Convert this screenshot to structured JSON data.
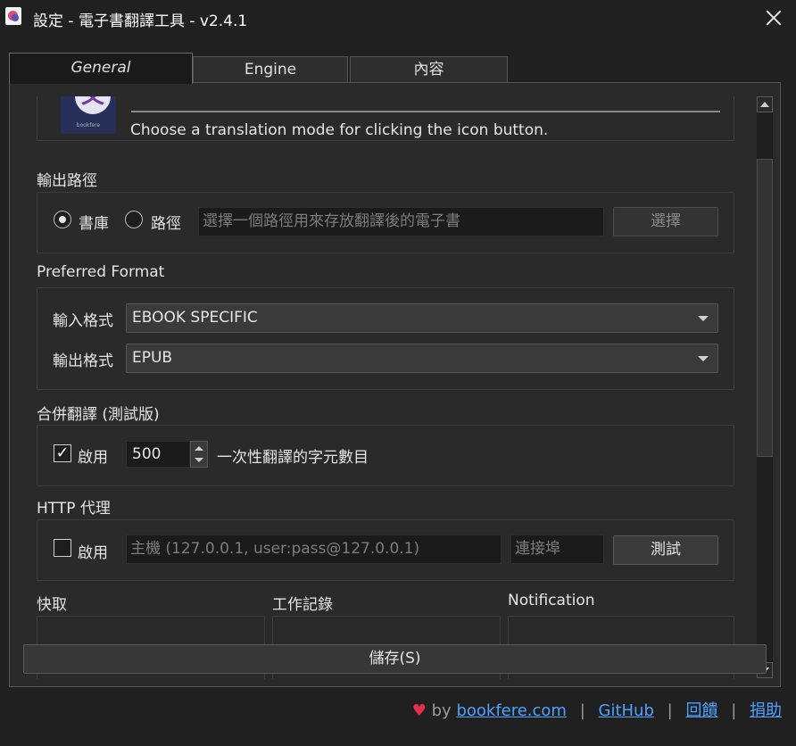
{
  "window": {
    "title": "設定 - 電子書翻譯工具 - v2.4.1"
  },
  "tabs": [
    {
      "label": "General"
    },
    {
      "label": "Engine"
    },
    {
      "label": "內容"
    }
  ],
  "mode": {
    "hint": "Choose a translation mode for clicking the icon button."
  },
  "output_path": {
    "label": "輸出路徑",
    "options": [
      "書庫",
      "路徑"
    ],
    "selected": "書庫",
    "path_placeholder": "選擇一個路徑用來存放翻譯後的電子書",
    "choose_label": "選擇"
  },
  "format": {
    "label": "Preferred Format",
    "input_label": "輸入格式",
    "input_value": "EBOOK SPECIFIC",
    "output_label": "輸出格式",
    "output_value": "EPUB"
  },
  "merge": {
    "label": "合併翻譯 (測試版)",
    "enable_label": "啟用",
    "enabled": true,
    "value": "500",
    "unit_label": "一次性翻譯的字元數目"
  },
  "proxy": {
    "label": "HTTP 代理",
    "enable_label": "啟用",
    "enabled": false,
    "host_placeholder": "主機 (127.0.0.1, user:pass@127.0.0.1)",
    "port_placeholder": "連接埠",
    "test_label": "測試"
  },
  "bottom_sections": [
    "快取",
    "工作記錄",
    "Notification"
  ],
  "save_label": "儲存(S)",
  "footer": {
    "by": "by",
    "links": [
      "bookfere.com",
      "GitHub",
      "回饋",
      "捐助"
    ],
    "separator": "|"
  },
  "colors": {
    "background": "#202020",
    "panel": "#2a2a2a",
    "link": "#4ea1ff",
    "heart": "#e0304a"
  }
}
